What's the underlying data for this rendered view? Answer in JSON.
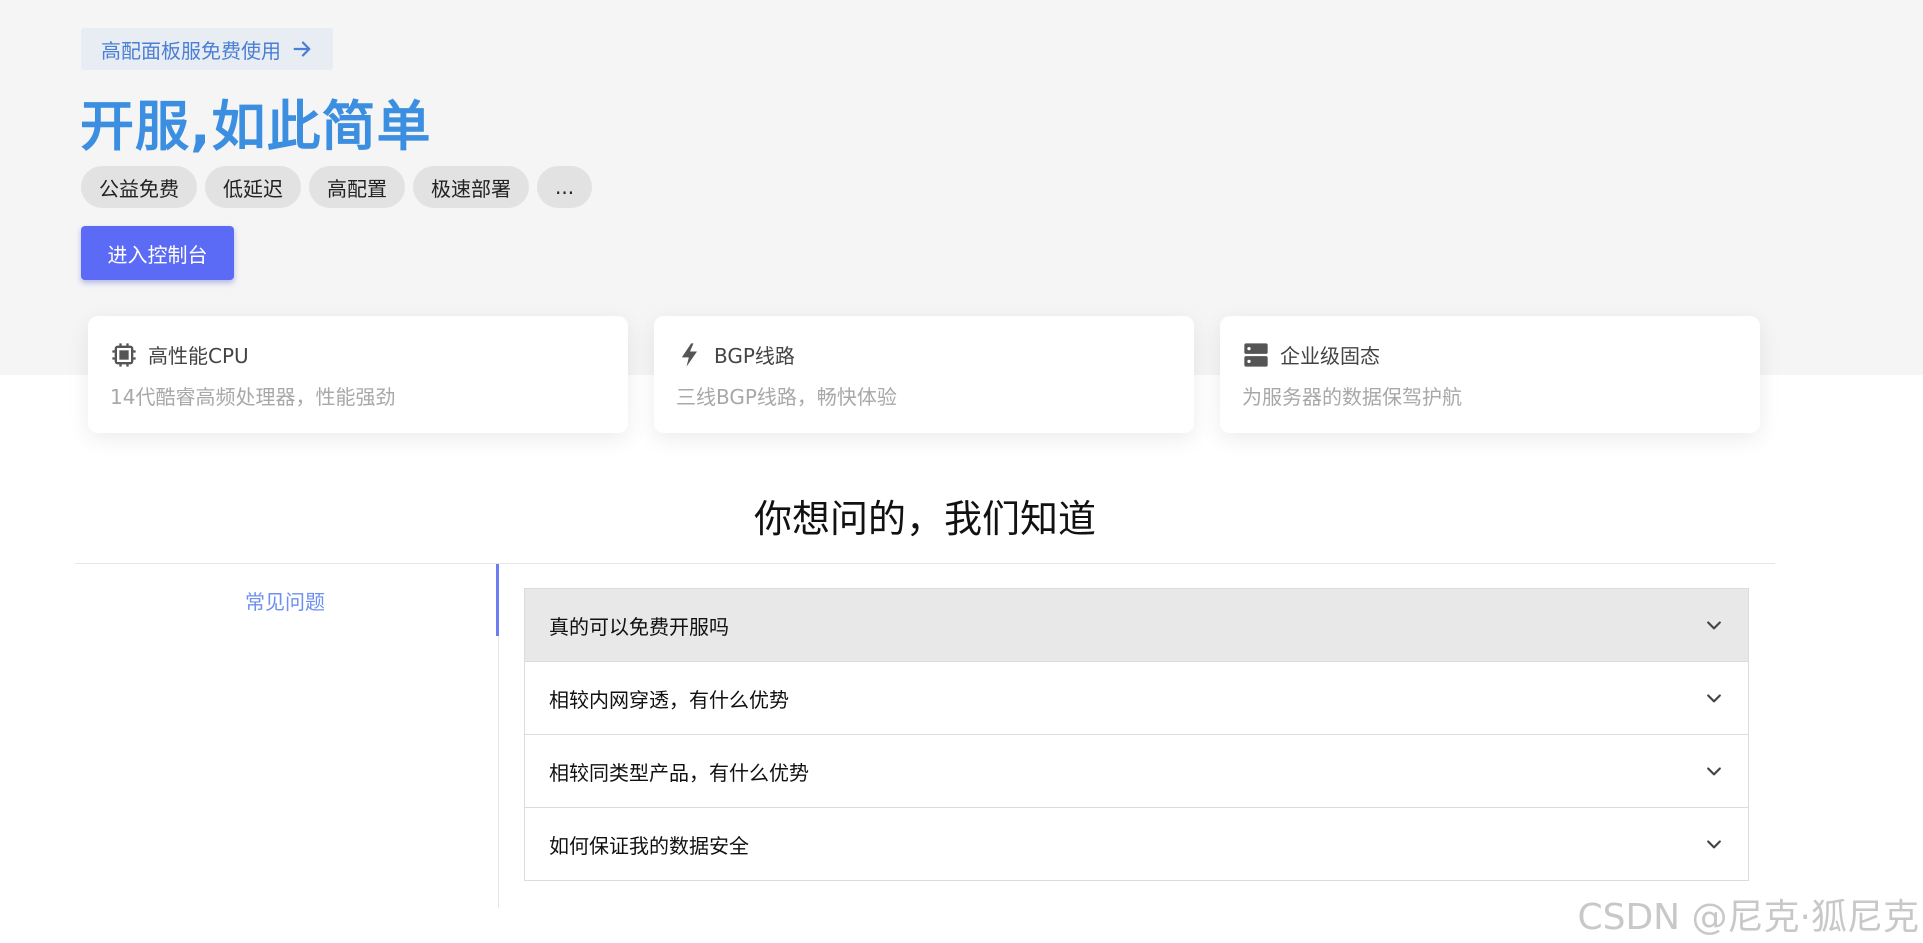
{
  "hero": {
    "promo_label": "高配面板服免费使用",
    "title": "开服,如此简单",
    "tags": [
      "公益免费",
      "低延迟",
      "高配置",
      "极速部署",
      "..."
    ],
    "console_button": "进入控制台"
  },
  "features": [
    {
      "icon": "cpu-icon",
      "title": "高性能CPU",
      "desc": "14代酷睿高频处理器，性能强劲"
    },
    {
      "icon": "lightning-icon",
      "title": "BGP线路",
      "desc": "三线BGP线路，畅快体验"
    },
    {
      "icon": "server-icon",
      "title": "企业级固态",
      "desc": "为服务器的数据保驾护航"
    }
  ],
  "faq": {
    "title": "你想问的，我们知道",
    "category": "常见问题",
    "items": [
      "真的可以免费开服吗",
      "相较内网穿透，有什么优势",
      "相较同类型产品，有什么优势",
      "如何保证我的数据安全"
    ]
  },
  "watermark": "CSDN @尼克·狐尼克",
  "colors": {
    "accent": "#3b8ee0",
    "button": "#5b6bf5",
    "category_active": "#6f8ff0"
  }
}
